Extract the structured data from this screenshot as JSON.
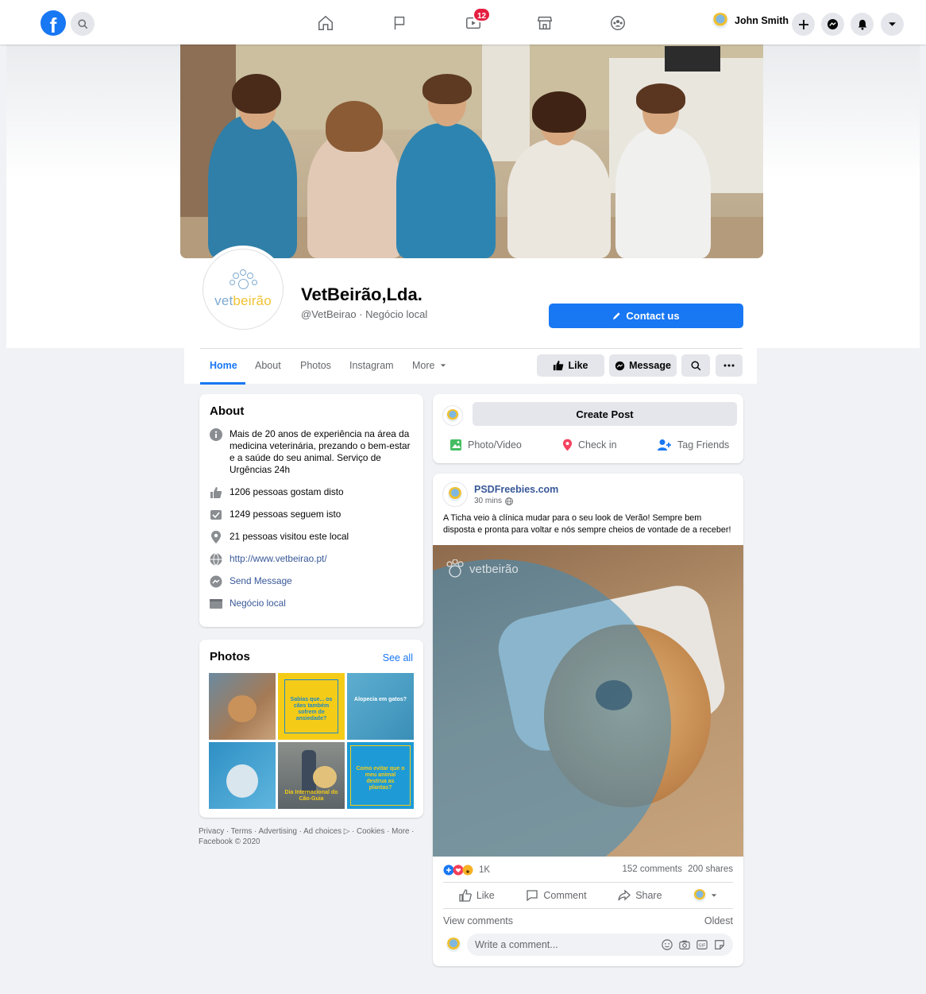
{
  "nav": {
    "user_name": "John Smith",
    "watch_badge": "12"
  },
  "page": {
    "name": "VetBeirão,Lda.",
    "handle": "@VetBeirao",
    "category": "Negócio local",
    "contact_label": "Contact us",
    "logo_text_a": "vet",
    "logo_text_b": "beirão"
  },
  "tabs": [
    {
      "label": "Home"
    },
    {
      "label": "About"
    },
    {
      "label": "Photos"
    },
    {
      "label": "Instagram"
    },
    {
      "label": "More"
    }
  ],
  "actions": {
    "like": "Like",
    "message": "Message"
  },
  "about": {
    "title": "About",
    "description": "Mais de 20 anos de experiência na área da medicina veterinária, prezando o bem-estar e a saúde do seu animal. Serviço de Urgências 24h",
    "likes": "1206 pessoas gostam disto",
    "follows": "1249 pessoas seguem isto",
    "visits": "21 pessoas visitou este local",
    "website": "http://www.vetbeirao.pt/",
    "send_message": "Send Message",
    "category": "Negócio local"
  },
  "photos": {
    "title": "Photos",
    "see_all": "See all",
    "items": [
      {
        "caption": ""
      },
      {
        "caption": "Sabias que... os cães também sofrem de ansiedade?"
      },
      {
        "caption": "Alopecia em gatos?"
      },
      {
        "caption": ""
      },
      {
        "caption": "Dia Internacional do Cão-Guia"
      },
      {
        "caption": "Como evitar que o meu animal destrua as plantas?"
      }
    ]
  },
  "footer": {
    "links": "Privacy · Terms · Advertising · Ad choices ▷ · Cookies · More ·",
    "copyright": "Facebook © 2020"
  },
  "create_post": {
    "title": "Create Post",
    "photo_video": "Photo/Video",
    "check_in": "Check in",
    "tag_friends": "Tag Friends"
  },
  "post": {
    "author": "PSDFreebies.com",
    "time": "30 mins",
    "text": "A Ticha veio à clínica mudar para o seu look de Verão! Sempre bem disposta e pronta para voltar e nós sempre cheios de vontade de a receber!",
    "watermark": "vetbeirão",
    "reactions_count": "1K",
    "comments": "152 comments",
    "shares": "200 shares",
    "like": "Like",
    "comment": "Comment",
    "share": "Share",
    "view_comments": "View comments",
    "sort": "Oldest",
    "comment_placeholder": "Write a comment..."
  },
  "colors": {
    "brand_blue": "#1877f2",
    "logo_blue": "#7eaad0",
    "logo_yellow": "#f1c232"
  }
}
